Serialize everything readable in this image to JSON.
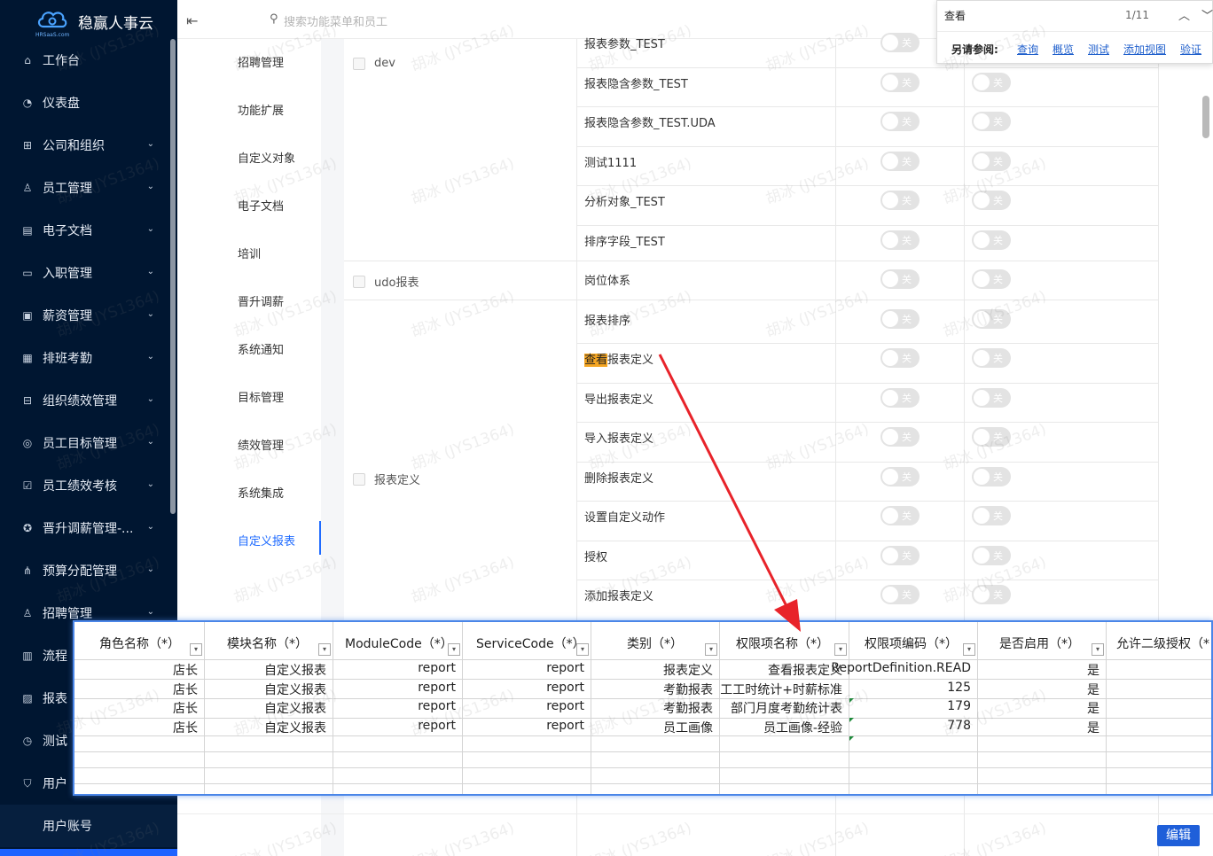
{
  "app": {
    "brand_name": "稳赢人事云",
    "brand_sub": "HRSaaS.com",
    "search_placeholder": "搜索功能菜单和员工"
  },
  "sidebar": {
    "items": [
      {
        "label": "工作台",
        "icon": "home-icon",
        "chev": ""
      },
      {
        "label": "仪表盘",
        "icon": "dashboard-icon",
        "chev": ""
      },
      {
        "label": "公司和组织",
        "icon": "org-icon",
        "chev": "⌄"
      },
      {
        "label": "员工管理",
        "icon": "user-icon",
        "chev": "⌄"
      },
      {
        "label": "电子文档",
        "icon": "doc-icon",
        "chev": "⌄"
      },
      {
        "label": "入职管理",
        "icon": "id-card-icon",
        "chev": "⌄"
      },
      {
        "label": "薪资管理",
        "icon": "wallet-icon",
        "chev": "⌄"
      },
      {
        "label": "排班考勤",
        "icon": "calendar-icon",
        "chev": "⌄"
      },
      {
        "label": "组织绩效管理",
        "icon": "tree-icon",
        "chev": "⌄"
      },
      {
        "label": "员工目标管理",
        "icon": "target-icon",
        "chev": "⌄"
      },
      {
        "label": "员工绩效考核",
        "icon": "check-card-icon",
        "chev": "⌄"
      },
      {
        "label": "晋升调薪管理-...",
        "icon": "badge-icon",
        "chev": "⌄"
      },
      {
        "label": "预算分配管理",
        "icon": "hierarchy-icon",
        "chev": "⌄"
      },
      {
        "label": "招聘管理",
        "icon": "person-search-icon",
        "chev": "⌄"
      },
      {
        "label": "流程",
        "icon": "flow-icon",
        "chev": ""
      },
      {
        "label": "报表",
        "icon": "chart-icon",
        "chev": ""
      },
      {
        "label": "测试",
        "icon": "clock-icon",
        "chev": ""
      },
      {
        "label": "用户",
        "icon": "shield-icon",
        "chev": ""
      }
    ],
    "sub_item": "用户账号"
  },
  "menu2": {
    "items": [
      "招聘管理",
      "功能扩展",
      "自定义对象",
      "电子文档",
      "培训",
      "晋升调薪",
      "系统通知",
      "目标管理",
      "绩效管理",
      "系统集成",
      "自定义报表"
    ],
    "active": "自定义报表"
  },
  "permissions": {
    "groups": [
      {
        "name": "dev"
      },
      {
        "name": "udo报表"
      },
      {
        "name": "报表定义"
      }
    ],
    "rows": [
      {
        "pre": "",
        "hl": "",
        "post": "报表参数_TEST"
      },
      {
        "pre": "",
        "hl": "",
        "post": "报表隐含参数_TEST"
      },
      {
        "pre": "",
        "hl": "",
        "post": "报表隐含参数_TEST.UDA"
      },
      {
        "pre": "",
        "hl": "",
        "post": "测试1111"
      },
      {
        "pre": "",
        "hl": "",
        "post": "分析对象_TEST"
      },
      {
        "pre": "",
        "hl": "",
        "post": "排序字段_TEST"
      },
      {
        "pre": "",
        "hl": "",
        "post": "岗位体系"
      },
      {
        "pre": "",
        "hl": "",
        "post": "报表排序"
      },
      {
        "pre": "",
        "hl": "查看",
        "post": "报表定义"
      },
      {
        "pre": "",
        "hl": "",
        "post": "导出报表定义"
      },
      {
        "pre": "",
        "hl": "",
        "post": "导入报表定义"
      },
      {
        "pre": "",
        "hl": "",
        "post": "删除报表定义"
      },
      {
        "pre": "",
        "hl": "",
        "post": "设置自定义动作"
      },
      {
        "pre": "",
        "hl": "",
        "post": "授权"
      },
      {
        "pre": "",
        "hl": "",
        "post": "添加报表定义"
      }
    ],
    "toggle_label": "关"
  },
  "find": {
    "query": "查看",
    "count": "1/11",
    "see_also": "另请参阅:",
    "links": [
      "查询",
      "概览",
      "测试",
      "添加视图",
      "验证"
    ]
  },
  "sheet": {
    "headers": [
      "角色名称（*）",
      "模块名称（*）",
      "ModuleCode（*）",
      "ServiceCode（*）",
      "类别（*）",
      "权限项名称（*）",
      "权限项编码（*）",
      "是否启用（*）",
      "允许二级授权（*"
    ],
    "rows": [
      [
        "店长",
        "自定义报表",
        "report",
        "report",
        "报表定义",
        "查看报表定义",
        "ReportDefinition.READ",
        "是"
      ],
      [
        "店长",
        "自定义报表",
        "report",
        "report",
        "考勤报表",
        "工工时统计+时薪标准",
        "125",
        "是"
      ],
      [
        "店长",
        "自定义报表",
        "report",
        "report",
        "考勤报表",
        "部门月度考勤统计表",
        "179",
        "是"
      ],
      [
        "店长",
        "自定义报表",
        "report",
        "report",
        "员工画像",
        "员工画像-经验",
        "778",
        "是"
      ]
    ]
  },
  "edit_button": "编辑",
  "watermark": [
    "胡冰 (JYS1364)",
    "JYS"
  ]
}
